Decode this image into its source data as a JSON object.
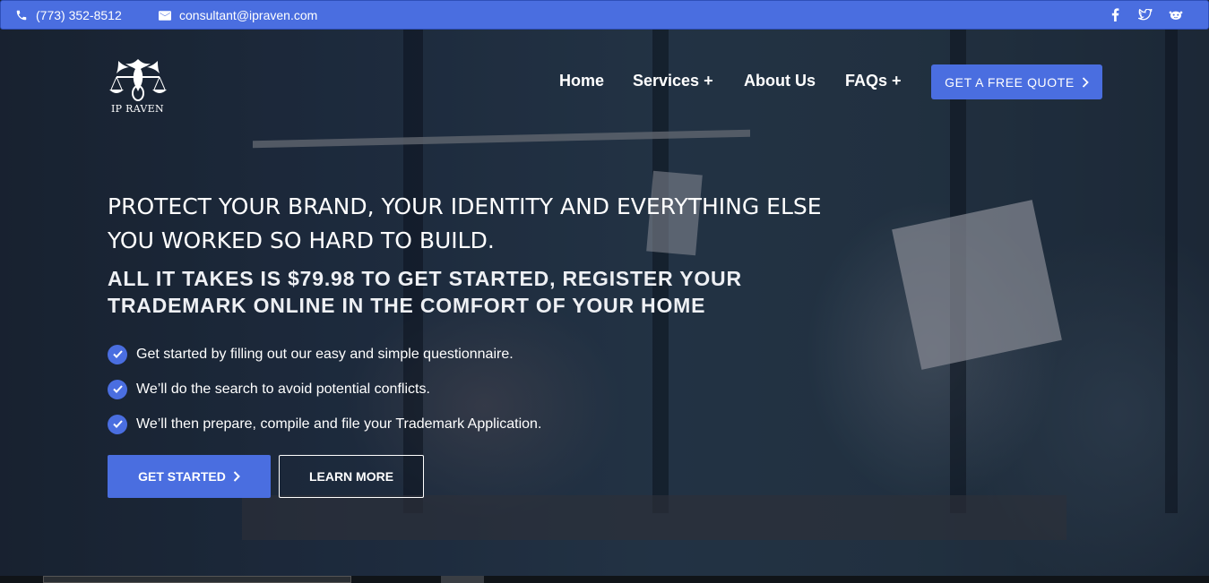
{
  "topbar": {
    "phone": "(773) 352-8512",
    "email": "consultant@ipraven.com",
    "social": [
      "facebook-icon",
      "twitter-icon",
      "reddit-icon"
    ]
  },
  "logo": {
    "text": "IP RAVEN"
  },
  "nav": {
    "home": "Home",
    "services": "Services +",
    "about": "About Us",
    "faqs": "FAQs +",
    "quote_button": "GET A FREE QUOTE"
  },
  "hero": {
    "headline": "PROTECT YOUR BRAND, YOUR IDENTITY AND EVERYTHING ELSE YOU WORKED SO HARD TO BUILD.",
    "subheadline": "ALL IT TAKES IS $79.98 TO GET STARTED, REGISTER YOUR TRADEMARK ONLINE IN THE COMFORT OF YOUR HOME",
    "checklist": [
      "Get started by filling out our easy and simple questionnaire.",
      "We’ll do the search to avoid potential conflicts.",
      "We’ll then prepare, compile and file your Trademark Application."
    ],
    "get_started": "GET STARTED",
    "learn_more": "LEARN MORE"
  },
  "colors": {
    "accent": "#4a6ee0"
  }
}
